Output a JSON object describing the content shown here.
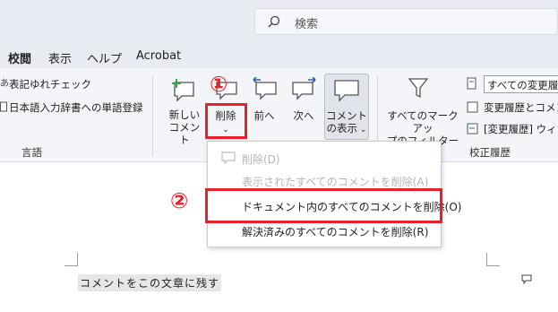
{
  "search": {
    "placeholder": "検索"
  },
  "tabs": [
    {
      "label": "校閲"
    },
    {
      "label": "表示"
    },
    {
      "label": "ヘルプ"
    },
    {
      "label": "Acrobat"
    }
  ],
  "ribbon": {
    "proofing": {
      "spelling_label": "表記ゆれチェック",
      "dictionary_label": "日本語入力辞書への単語登録",
      "group_label": "言語"
    },
    "comments": {
      "new_comment_label": [
        "新しい",
        "コメント"
      ],
      "delete_label": "削除",
      "prev_label": "前へ",
      "next_label": "次へ",
      "show_comments_label": [
        "コメント",
        "の表示"
      ]
    },
    "tracking": {
      "markup_filter_label": [
        "すべてのマークアッ",
        "プのフィルター"
      ],
      "all_markup_value": "すべての変更履",
      "pane_label": "変更履歴とコメン",
      "track_changes_label": "[変更履歴] ウィ",
      "group_label": "校正履歴"
    }
  },
  "annotations": {
    "step1": "①",
    "step2": "②"
  },
  "delete_menu": {
    "items": [
      {
        "label": "削除(D)",
        "enabled": false
      },
      {
        "label": "表示されたすべてのコメントを削除(A)",
        "enabled": false
      },
      {
        "label": "ドキュメント内のすべてのコメントを削除(O)",
        "enabled": true
      },
      {
        "label": "解決済みのすべてのコメントを削除(R)",
        "enabled": true
      }
    ]
  },
  "document": {
    "text": "コメントをこの文章に残す"
  },
  "colors": {
    "accent": "#2a62b8",
    "highlight": "#e8202a",
    "green": "#3aa345"
  }
}
